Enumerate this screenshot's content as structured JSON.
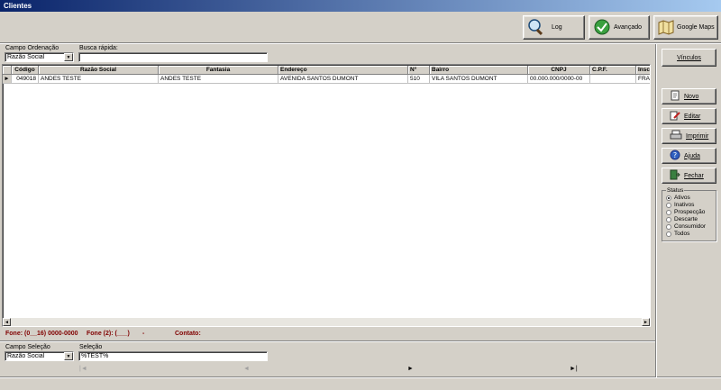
{
  "window": {
    "title": "Clientes"
  },
  "toolbar": {
    "log_label": "Log",
    "avancado_label": "Avançado",
    "maps_label": "Google Maps"
  },
  "ordenacao": {
    "label": "Campo Ordenação",
    "value": "Razão Social"
  },
  "busca": {
    "label": "Busca rápida:",
    "value": ""
  },
  "grid": {
    "columns": [
      "Código",
      "Razão Social",
      "Fantasia",
      "Endereço",
      "N°",
      "Bairro",
      "CNPJ",
      "C.P.F.",
      "Inscrição"
    ],
    "rows": [
      [
        "049018",
        "ANDES TESTE",
        "ANDES TESTE",
        "AVENIDA SANTOS DUMONT",
        "510",
        "VILA SANTOS DUMONT",
        "00.000.000/0000-00",
        "",
        "FRAN"
      ]
    ]
  },
  "info": {
    "fone": "Fone: (0__16) 0000-0000",
    "fone2": "Fone (2): (___)",
    "dash": "-",
    "contato": "Contato:"
  },
  "selecao": {
    "campo_label": "Campo Seleção",
    "campo_value": "Razão Social",
    "sel_label": "Seleção",
    "sel_value": "%TEST%"
  },
  "side": {
    "vinculos": "Vínculos",
    "novo": "Novo",
    "editar": "Editar",
    "imprimir": "Imprimir",
    "ajuda": "Ajuda",
    "fechar": "Fechar"
  },
  "status": {
    "title": "Status",
    "options": [
      "Ativos",
      "Inativos",
      "Prospecção",
      "Descarte",
      "Consumidor",
      "Todos"
    ],
    "selected": "Ativos"
  },
  "nav": {
    "first": "|◄",
    "prev": "◄",
    "next": "►",
    "last": "►|"
  },
  "icons": [
    "magnifier-icon",
    "checkmark-icon",
    "map-icon",
    "new-doc-icon",
    "edit-icon",
    "printer-icon",
    "help-icon",
    "exit-icon"
  ]
}
